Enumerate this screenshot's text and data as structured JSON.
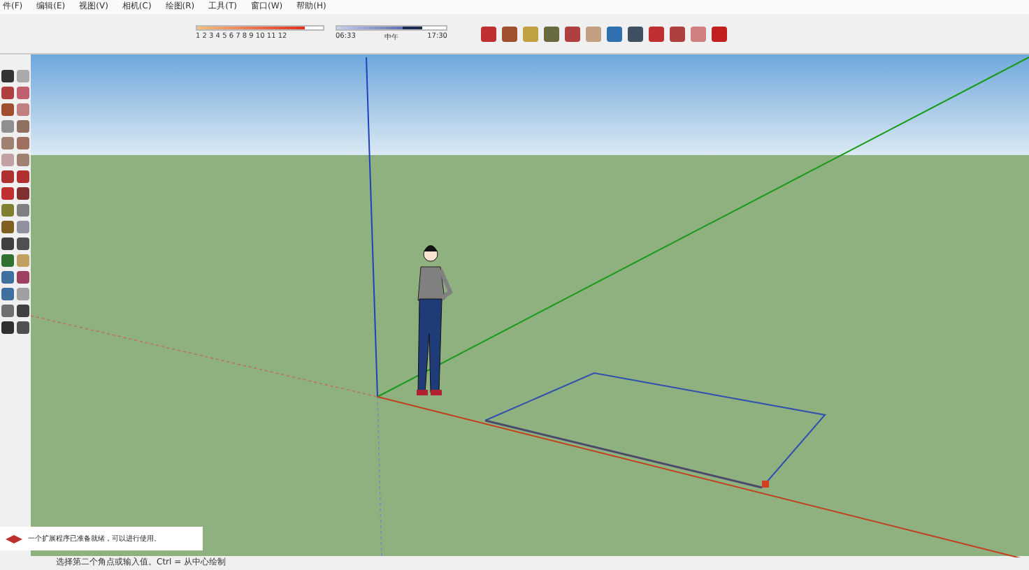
{
  "menu": [
    "件(F)",
    "编辑(E)",
    "视图(V)",
    "相机(C)",
    "绘图(R)",
    "工具(T)",
    "窗口(W)",
    "帮助(H)"
  ],
  "shadow_settings": {
    "months": "1 2 3 4 5 6 7 8 9 10 11 12",
    "time_start": "06:33",
    "time_mid": "中午",
    "time_end": "17:30",
    "date_slider": {
      "level": 0.86
    },
    "time_slider": {
      "level": 0.78
    }
  },
  "notification": {
    "text": "一个扩展程序已准备就绪，可以进行使用。"
  },
  "status_bar": {
    "text": "选择第二个角点或输入值。Ctrl = 从中心绘制"
  }
}
